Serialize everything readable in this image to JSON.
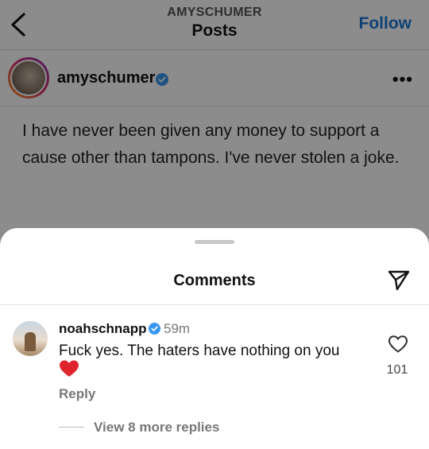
{
  "header": {
    "account": "AMYSCHUMER",
    "title": "Posts",
    "follow_label": "Follow"
  },
  "post": {
    "username": "amyschumer",
    "more_label": "•••",
    "text": "I have never been given any money to support a cause other than tampons. I've never stolen a joke."
  },
  "comments_sheet": {
    "title": "Comments",
    "comment": {
      "username": "noahschnapp",
      "time": "59m",
      "text": "Fuck yes. The haters have nothing on you",
      "emoji": "heart",
      "like_count": "101",
      "reply_label": "Reply",
      "view_replies_label": "View 8 more replies"
    }
  },
  "colors": {
    "accent": "#1a78d6",
    "verified": "#3897f0",
    "heart": "#e0242b"
  }
}
